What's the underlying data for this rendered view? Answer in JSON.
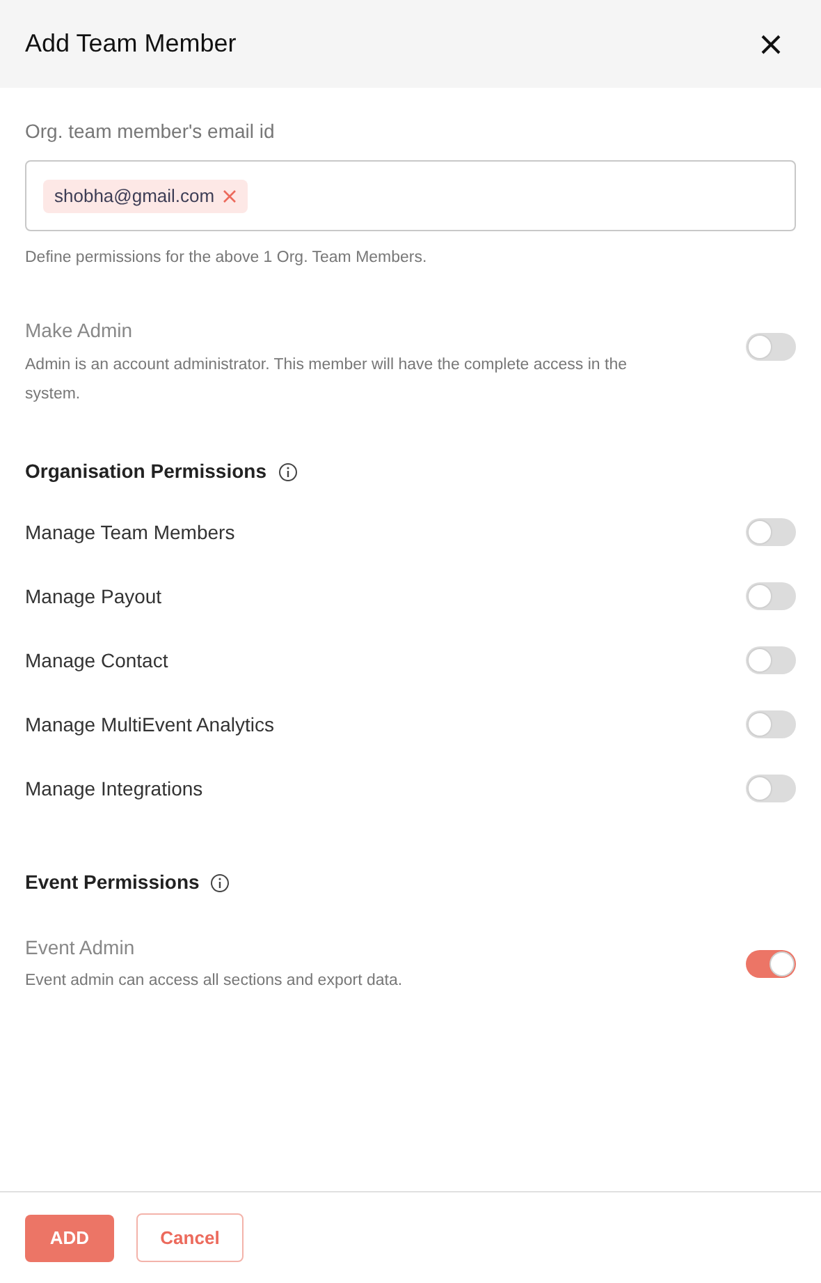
{
  "header": {
    "title": "Add Team Member"
  },
  "email_field": {
    "label": "Org. team member's email id",
    "tags": [
      {
        "text": "shobha@gmail.com"
      }
    ],
    "helper": "Define permissions for the above 1 Org. Team Members."
  },
  "make_admin": {
    "label": "Make Admin",
    "description": "Admin is an account administrator. This member will have the complete access in the system.",
    "on": false
  },
  "sections": [
    {
      "title": "Organisation Permissions",
      "items": [
        {
          "label": "Manage Team Members",
          "on": false
        },
        {
          "label": "Manage Payout",
          "on": false
        },
        {
          "label": "Manage Contact",
          "on": false
        },
        {
          "label": "Manage MultiEvent Analytics",
          "on": false
        },
        {
          "label": "Manage Integrations",
          "on": false
        }
      ]
    },
    {
      "title": "Event Permissions",
      "items": [
        {
          "label": "Event Admin",
          "description": "Event admin can access all sections and export data.",
          "on": true
        }
      ]
    }
  ],
  "footer": {
    "primary": "ADD",
    "secondary": "Cancel"
  }
}
